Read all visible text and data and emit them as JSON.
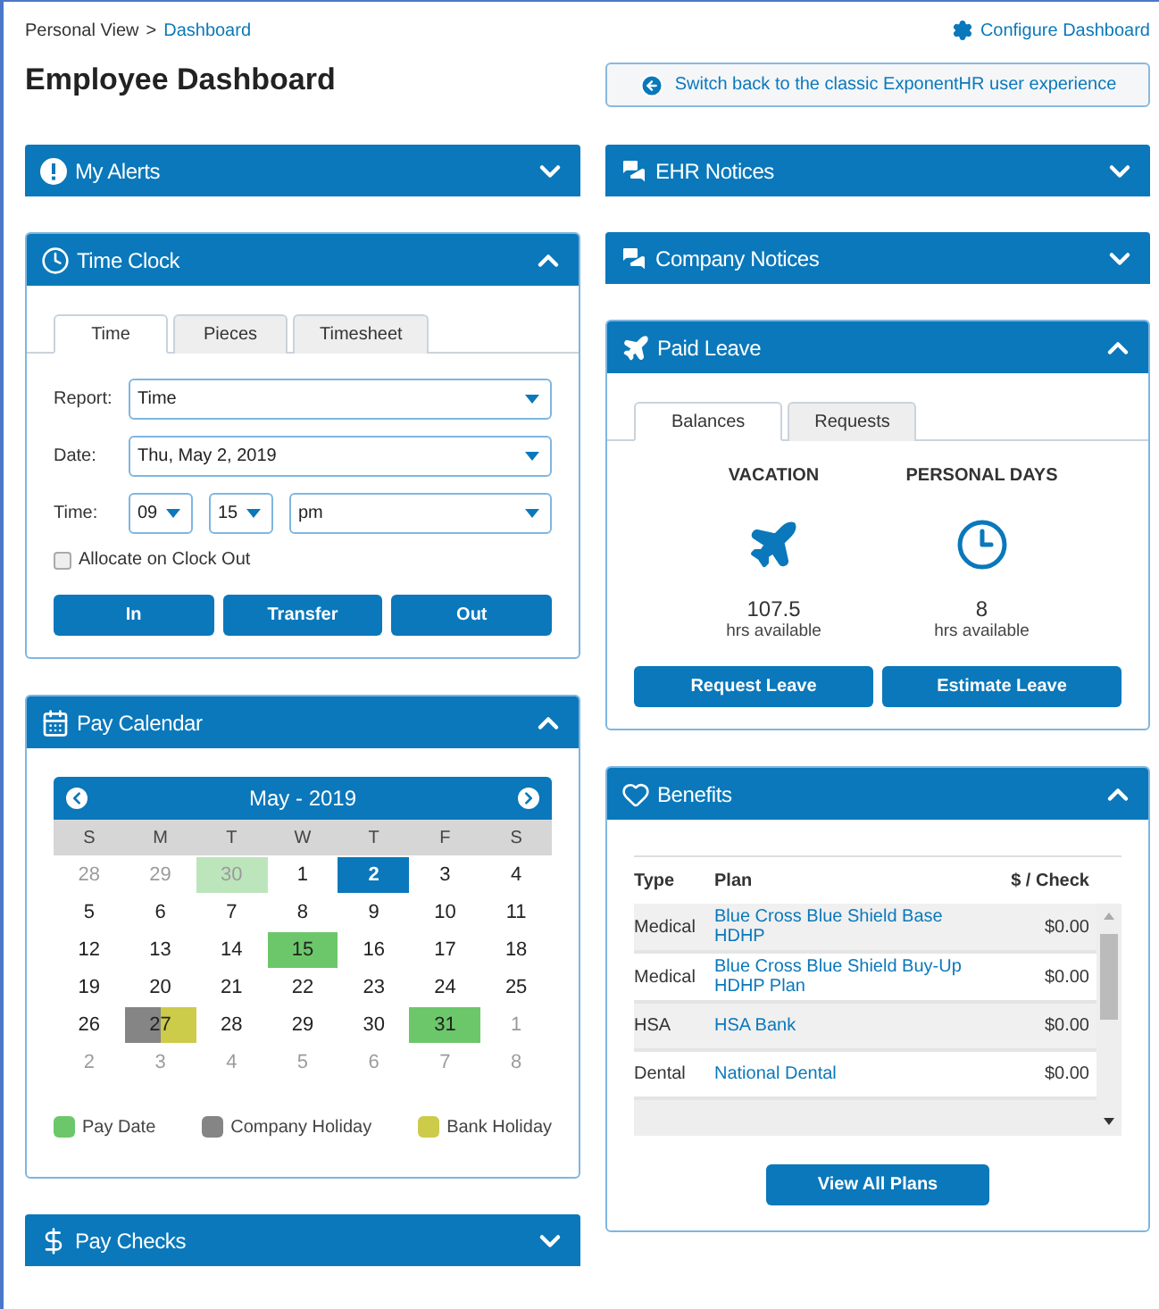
{
  "breadcrumb": {
    "parent": "Personal View",
    "separator": ">",
    "current": "Dashboard"
  },
  "configure_link": "Configure Dashboard",
  "title": "Employee Dashboard",
  "switch_button": "Switch back to the classic ExponentHR user experience",
  "left_panels": [
    {
      "kind": "alerts",
      "title": "My Alerts",
      "expanded": false
    },
    {
      "kind": "time_clock",
      "title": "Time Clock",
      "expanded": true,
      "tabs": [
        {
          "label": "Time",
          "selected": true
        },
        {
          "label": "Pieces",
          "selected": false
        },
        {
          "label": "Timesheet",
          "selected": false
        }
      ],
      "report": {
        "label": "Report:",
        "value": "Time"
      },
      "date": {
        "label": "Date:",
        "value": "Thu, May 2, 2019"
      },
      "time": {
        "label": "Time:",
        "hour": "09",
        "minute": "15",
        "period": "pm"
      },
      "allocate": {
        "label": "Allocate on Clock Out",
        "checked": false
      },
      "buttons": [
        "In",
        "Transfer",
        "Out"
      ]
    },
    {
      "kind": "pay_calendar",
      "title": "Pay Calendar",
      "expanded": true,
      "month": "May - 2019",
      "weekdays": [
        "S",
        "M",
        "T",
        "W",
        "T",
        "F",
        "S"
      ],
      "days": [
        {
          "label": "28",
          "muted": true,
          "kind": "plain"
        },
        {
          "label": "29",
          "muted": true,
          "kind": "plain"
        },
        {
          "label": "30",
          "muted": true,
          "kind": "pay"
        },
        {
          "label": "1",
          "muted": false,
          "kind": "plain"
        },
        {
          "label": "2",
          "muted": false,
          "kind": "today"
        },
        {
          "label": "3",
          "muted": false,
          "kind": "plain"
        },
        {
          "label": "4",
          "muted": false,
          "kind": "plain"
        },
        {
          "label": "5",
          "muted": false,
          "kind": "plain"
        },
        {
          "label": "6",
          "muted": false,
          "kind": "plain"
        },
        {
          "label": "7",
          "muted": false,
          "kind": "plain"
        },
        {
          "label": "8",
          "muted": false,
          "kind": "plain"
        },
        {
          "label": "9",
          "muted": false,
          "kind": "plain"
        },
        {
          "label": "10",
          "muted": false,
          "kind": "plain"
        },
        {
          "label": "11",
          "muted": false,
          "kind": "plain"
        },
        {
          "label": "12",
          "muted": false,
          "kind": "plain"
        },
        {
          "label": "13",
          "muted": false,
          "kind": "plain"
        },
        {
          "label": "14",
          "muted": false,
          "kind": "plain"
        },
        {
          "label": "15",
          "muted": false,
          "kind": "pay"
        },
        {
          "label": "16",
          "muted": false,
          "kind": "plain"
        },
        {
          "label": "17",
          "muted": false,
          "kind": "plain"
        },
        {
          "label": "18",
          "muted": false,
          "kind": "plain"
        },
        {
          "label": "19",
          "muted": false,
          "kind": "plain"
        },
        {
          "label": "20",
          "muted": false,
          "kind": "plain"
        },
        {
          "label": "21",
          "muted": false,
          "kind": "plain"
        },
        {
          "label": "22",
          "muted": false,
          "kind": "plain"
        },
        {
          "label": "23",
          "muted": false,
          "kind": "plain"
        },
        {
          "label": "24",
          "muted": false,
          "kind": "plain"
        },
        {
          "label": "25",
          "muted": false,
          "kind": "plain"
        },
        {
          "label": "26",
          "muted": false,
          "kind": "plain"
        },
        {
          "label": "27",
          "muted": false,
          "kind": "holiday"
        },
        {
          "label": "28",
          "muted": false,
          "kind": "plain"
        },
        {
          "label": "29",
          "muted": false,
          "kind": "plain"
        },
        {
          "label": "30",
          "muted": false,
          "kind": "plain"
        },
        {
          "label": "31",
          "muted": false,
          "kind": "pay"
        },
        {
          "label": "1",
          "muted": true,
          "kind": "plain"
        },
        {
          "label": "2",
          "muted": true,
          "kind": "plain"
        },
        {
          "label": "3",
          "muted": true,
          "kind": "plain"
        },
        {
          "label": "4",
          "muted": true,
          "kind": "plain"
        },
        {
          "label": "5",
          "muted": true,
          "kind": "plain"
        },
        {
          "label": "6",
          "muted": true,
          "kind": "plain"
        },
        {
          "label": "7",
          "muted": true,
          "kind": "plain"
        },
        {
          "label": "8",
          "muted": true,
          "kind": "plain"
        }
      ],
      "legend": [
        {
          "label": "Pay Date",
          "color": "#6cc76a"
        },
        {
          "label": "Company Holiday",
          "color": "#858585"
        },
        {
          "label": "Bank Holiday",
          "color": "#cccb4a"
        }
      ]
    },
    {
      "kind": "pay_checks",
      "title": "Pay Checks",
      "expanded": false
    }
  ],
  "right_panels": [
    {
      "kind": "ehr_notices",
      "title": "EHR Notices",
      "expanded": false
    },
    {
      "kind": "company_notices",
      "title": "Company Notices",
      "expanded": false
    },
    {
      "kind": "paid_leave",
      "title": "Paid Leave",
      "expanded": true,
      "tabs": [
        {
          "label": "Balances",
          "selected": true
        },
        {
          "label": "Requests",
          "selected": false
        }
      ],
      "balances": [
        {
          "name": "VACATION",
          "kind": "plane",
          "amount": "107.5",
          "unit": "hrs available"
        },
        {
          "name": "PERSONAL DAYS",
          "kind": "clock",
          "amount": "8",
          "unit": "hrs available"
        }
      ],
      "buttons": [
        "Request Leave",
        "Estimate Leave"
      ]
    },
    {
      "kind": "benefits",
      "title": "Benefits",
      "expanded": true,
      "columns": [
        "Type",
        "Plan",
        "$ / Check"
      ],
      "rows": [
        {
          "type": "Medical",
          "plan": "Blue Cross Blue Shield Base HDHP",
          "amount": "$0.00"
        },
        {
          "type": "Medical",
          "plan": "Blue Cross Blue Shield Buy-Up HDHP Plan",
          "amount": "$0.00"
        },
        {
          "type": "HSA",
          "plan": "HSA Bank",
          "amount": "$0.00"
        },
        {
          "type": "Dental",
          "plan": "National Dental",
          "amount": "$0.00"
        }
      ],
      "button": "View All Plans"
    }
  ]
}
